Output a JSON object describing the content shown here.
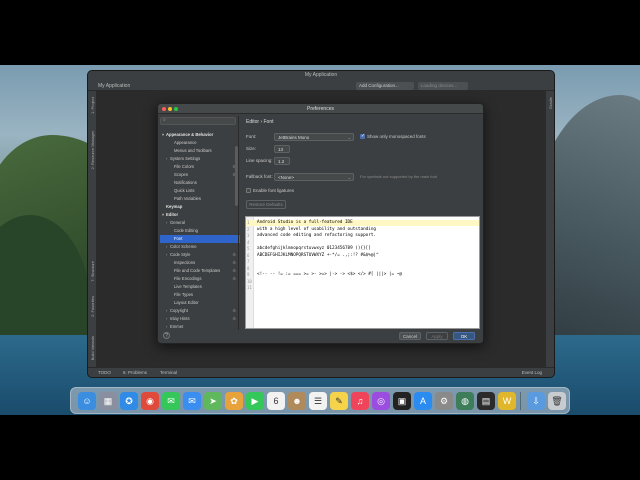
{
  "ide": {
    "title": "My Application",
    "breadcrumb": "My Application",
    "config_label": "Add Configuration...",
    "device_label": "Loading devices...",
    "left_strip": [
      "1: Project",
      "2: Resource Manager",
      "7: Structure",
      "2: Favorites",
      "Build Variants"
    ],
    "right_strip": [
      "Gradle"
    ],
    "bottom_tabs": [
      "TODO",
      "6: Problems",
      "Terminal"
    ],
    "event_log": "Event Log"
  },
  "dialog": {
    "title": "Preferences",
    "breadcrumb": "Editor  ›  Font",
    "tree": [
      {
        "label": "Appearance & Behavior",
        "level": 0,
        "bold": true,
        "arrow": "▾"
      },
      {
        "label": "Appearance",
        "level": 2
      },
      {
        "label": "Menus and Toolbars",
        "level": 2
      },
      {
        "label": "System Settings",
        "level": 1,
        "arrow": "›"
      },
      {
        "label": "File Colors",
        "level": 2,
        "cfg": "⚙"
      },
      {
        "label": "Scopes",
        "level": 2,
        "cfg": "⚙"
      },
      {
        "label": "Notifications",
        "level": 2
      },
      {
        "label": "Quick Lists",
        "level": 2
      },
      {
        "label": "Path Variables",
        "level": 2
      },
      {
        "label": "Keymap",
        "level": 0,
        "bold": true
      },
      {
        "label": "Editor",
        "level": 0,
        "bold": true,
        "arrow": "▾"
      },
      {
        "label": "General",
        "level": 1,
        "arrow": "›"
      },
      {
        "label": "Code Editing",
        "level": 2
      },
      {
        "label": "Font",
        "level": 2,
        "selected": true
      },
      {
        "label": "Color Scheme",
        "level": 1,
        "arrow": "›"
      },
      {
        "label": "Code Style",
        "level": 1,
        "arrow": "›",
        "cfg": "⚙"
      },
      {
        "label": "Inspections",
        "level": 2,
        "cfg": "⚙"
      },
      {
        "label": "File and Code Templates",
        "level": 2,
        "cfg": "⚙"
      },
      {
        "label": "File Encodings",
        "level": 2,
        "cfg": "⚙"
      },
      {
        "label": "Live Templates",
        "level": 2
      },
      {
        "label": "File Types",
        "level": 2
      },
      {
        "label": "Layout Editor",
        "level": 2
      },
      {
        "label": "Copyright",
        "level": 1,
        "arrow": "›",
        "cfg": "⚙"
      },
      {
        "label": "Inlay Hints",
        "level": 1,
        "arrow": "›",
        "cfg": "⚙"
      },
      {
        "label": "Emmet",
        "level": 1,
        "arrow": "›"
      }
    ],
    "font_label": "Font:",
    "font_value": "JetBrains Mono",
    "mono_only_label": "Show only monospaced fonts",
    "mono_only_checked": true,
    "size_label": "Size:",
    "size_value": "13",
    "line_spacing_label": "Line spacing:",
    "line_spacing_value": "1.2",
    "fallback_label": "Fallback font:",
    "fallback_value": "<None>",
    "fallback_hint": "For symbols not supported by the main font",
    "ligatures_label": "Enable font ligatures",
    "ligatures_checked": false,
    "restore_label": "Restore Defaults",
    "preview_lines": [
      "Android Studio is a full-featured IDE",
      "with a high level of usability and outstanding",
      "advanced code editing and refactoring support.",
      "",
      "abcdefghijklmnopqrstuvwxyz 0123456789 (){}[]",
      "ABCDEFGHIJKLMNOPQRSTUVWXYZ +-*/= .,;:!? #&$%@|^",
      "",
      "",
      "<!-- -- != := === >= >- >=> |-> -> <$> </> #[ |||> |= ~@",
      "",
      ""
    ],
    "cancel_label": "Cancel",
    "apply_label": "Apply",
    "ok_label": "OK",
    "help_label": "?"
  },
  "dock": {
    "icons": [
      {
        "name": "finder-icon",
        "glyph": "☺",
        "color": "#3b8de0"
      },
      {
        "name": "launchpad-icon",
        "glyph": "▦",
        "color": "#8a8fa0"
      },
      {
        "name": "safari-icon",
        "glyph": "✪",
        "color": "#2f8be6"
      },
      {
        "name": "chrome-icon",
        "glyph": "◉",
        "color": "#e04a3a"
      },
      {
        "name": "messages-icon",
        "glyph": "✉",
        "color": "#35c759"
      },
      {
        "name": "mail-icon",
        "glyph": "✉",
        "color": "#3a8ef0"
      },
      {
        "name": "maps-icon",
        "glyph": "➤",
        "color": "#5fb85c"
      },
      {
        "name": "photos-icon",
        "glyph": "✿",
        "color": "#e7a23b"
      },
      {
        "name": "facetime-icon",
        "glyph": "▶",
        "color": "#34c759"
      },
      {
        "name": "calendar-icon",
        "glyph": "6",
        "color": "#f2f2f2"
      },
      {
        "name": "contacts-icon",
        "glyph": "☻",
        "color": "#b08a5a"
      },
      {
        "name": "reminders-icon",
        "glyph": "☰",
        "color": "#f2f2f2"
      },
      {
        "name": "notes-icon",
        "glyph": "✎",
        "color": "#f5d34a"
      },
      {
        "name": "music-icon",
        "glyph": "♫",
        "color": "#f0445a"
      },
      {
        "name": "podcasts-icon",
        "glyph": "◎",
        "color": "#9b4de0"
      },
      {
        "name": "tv-icon",
        "glyph": "▣",
        "color": "#222222"
      },
      {
        "name": "app-store-icon",
        "glyph": "A",
        "color": "#2a8cf0"
      },
      {
        "name": "system-preferences-icon",
        "glyph": "⚙",
        "color": "#8a8a8a"
      },
      {
        "name": "android-studio-icon",
        "glyph": "◍",
        "color": "#3d7d5a"
      },
      {
        "name": "activity-monitor-icon",
        "glyph": "▤",
        "color": "#2b2b2b"
      },
      {
        "name": "webstorm-icon",
        "glyph": "W",
        "color": "#e0b62a"
      },
      {
        "name": "downloads-icon",
        "glyph": "⇩",
        "color": "#5a9be0"
      },
      {
        "name": "trash-icon",
        "glyph": "🗑",
        "color": "#c8ccd0"
      }
    ]
  },
  "colors": {
    "accent": "#2f65ca",
    "dialog_bg": "#3c3f41",
    "ide_bg": "#2b2b2b"
  }
}
